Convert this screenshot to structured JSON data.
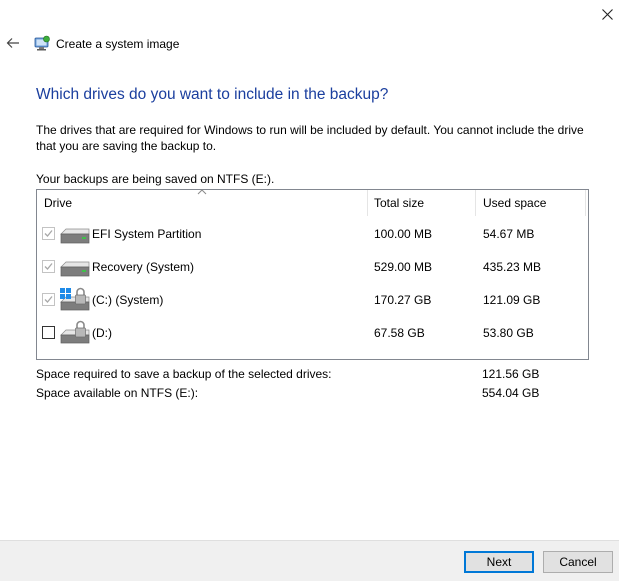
{
  "window": {
    "title": "Create a system image",
    "close_glyph": "✕",
    "back_glyph": "←"
  },
  "heading": "Which drives do you want to include in the backup?",
  "description": "The drives that are required for Windows to run will be included by default. You cannot include the drive that you are saving the backup to.",
  "saved_on": "Your backups are being saved on NTFS (E:).",
  "table": {
    "columns": [
      "Drive",
      "Total size",
      "Used space"
    ],
    "sorted_column": "Drive",
    "rows": [
      {
        "name": "EFI System Partition",
        "total": "100.00 MB",
        "used": "54.67 MB",
        "checked": true,
        "disabled": true,
        "icon": "drive-icon"
      },
      {
        "name": "Recovery (System)",
        "total": "529.00 MB",
        "used": "435.23 MB",
        "checked": true,
        "disabled": true,
        "icon": "drive-icon"
      },
      {
        "name": "(C:) (System)",
        "total": "170.27 GB",
        "used": "121.09 GB",
        "checked": true,
        "disabled": true,
        "icon": "windows-locked-drive-icon"
      },
      {
        "name": "(D:)",
        "total": "67.58 GB",
        "used": "53.80 GB",
        "checked": false,
        "disabled": false,
        "icon": "locked-drive-icon"
      }
    ]
  },
  "summary": {
    "required_label": "Space required to save a backup of the selected drives:",
    "required_value": "121.56 GB",
    "available_label": "Space available on NTFS (E:):",
    "available_value": "554.04 GB"
  },
  "buttons": {
    "next": "Next",
    "cancel": "Cancel"
  },
  "colors": {
    "heading": "#1a3e9e",
    "accent": "#0078d7",
    "footer_bg": "#f0f0f0"
  }
}
